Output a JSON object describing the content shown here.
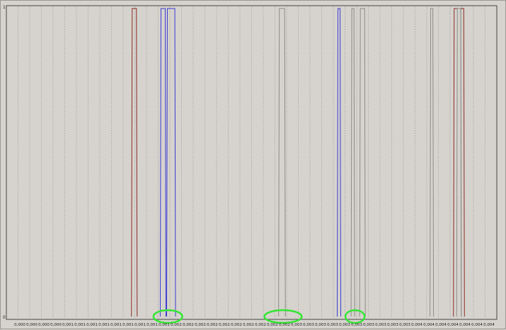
{
  "chart_data": {
    "type": "line",
    "title": "",
    "xlabel": "",
    "ylabel": "",
    "ylim": [
      0,
      1
    ],
    "y_ticks": [
      "1",
      "0"
    ],
    "x_tick_labels": [
      "0,000",
      "0,000",
      "0,000",
      "0,000",
      "0,001",
      "0,001",
      "0,001",
      "0,001",
      "0,001",
      "0,001",
      "0,001",
      "0,001",
      "0,001",
      "0,002",
      "0,002",
      "0,002",
      "0,002",
      "0,002",
      "0,002",
      "0,002",
      "0,002",
      "0,002",
      "0,002",
      "0,003",
      "0,003",
      "0,003",
      "0,003",
      "0,003",
      "0,003",
      "0,003",
      "0,003",
      "0,003",
      "0,003",
      "0,004",
      "0,004",
      "0,004",
      "0,004",
      "0,004",
      "0,004",
      "0,004"
    ],
    "grid": true,
    "colors": {
      "background": "#d6d3ce",
      "grid": "#8c8c8c",
      "axis": "#333333",
      "highlight": "#33e633"
    },
    "series": [
      {
        "color": "#8b2a22",
        "pulses": [
          {
            "x_start": 0.00118,
            "x_end": 0.00122
          },
          {
            "x_start": 0.0042,
            "x_end": 0.00429
          }
        ]
      },
      {
        "color": "#3b3bd1",
        "pulses": [
          {
            "x_start": 0.00145,
            "x_end": 0.00149
          },
          {
            "x_start": 0.00151,
            "x_end": 0.00158
          },
          {
            "x_start": 0.00311,
            "x_end": 0.00313
          }
        ]
      },
      {
        "color": "#8e8b86",
        "pulses": [
          {
            "x_start": 0.00256,
            "x_end": 0.00261
          },
          {
            "x_start": 0.00324,
            "x_end": 0.00326
          },
          {
            "x_start": 0.00332,
            "x_end": 0.00336
          },
          {
            "x_start": 0.00398,
            "x_end": 0.004
          },
          {
            "x_start": 0.00423,
            "x_end": 0.00426
          }
        ]
      }
    ],
    "highlight_regions": [
      {
        "x_start": 0.00138,
        "x_end": 0.00165
      },
      {
        "x_start": 0.00242,
        "x_end": 0.00277
      },
      {
        "x_start": 0.00318,
        "x_end": 0.00336
      }
    ],
    "x_range": [
      0.0,
      0.0046
    ]
  }
}
